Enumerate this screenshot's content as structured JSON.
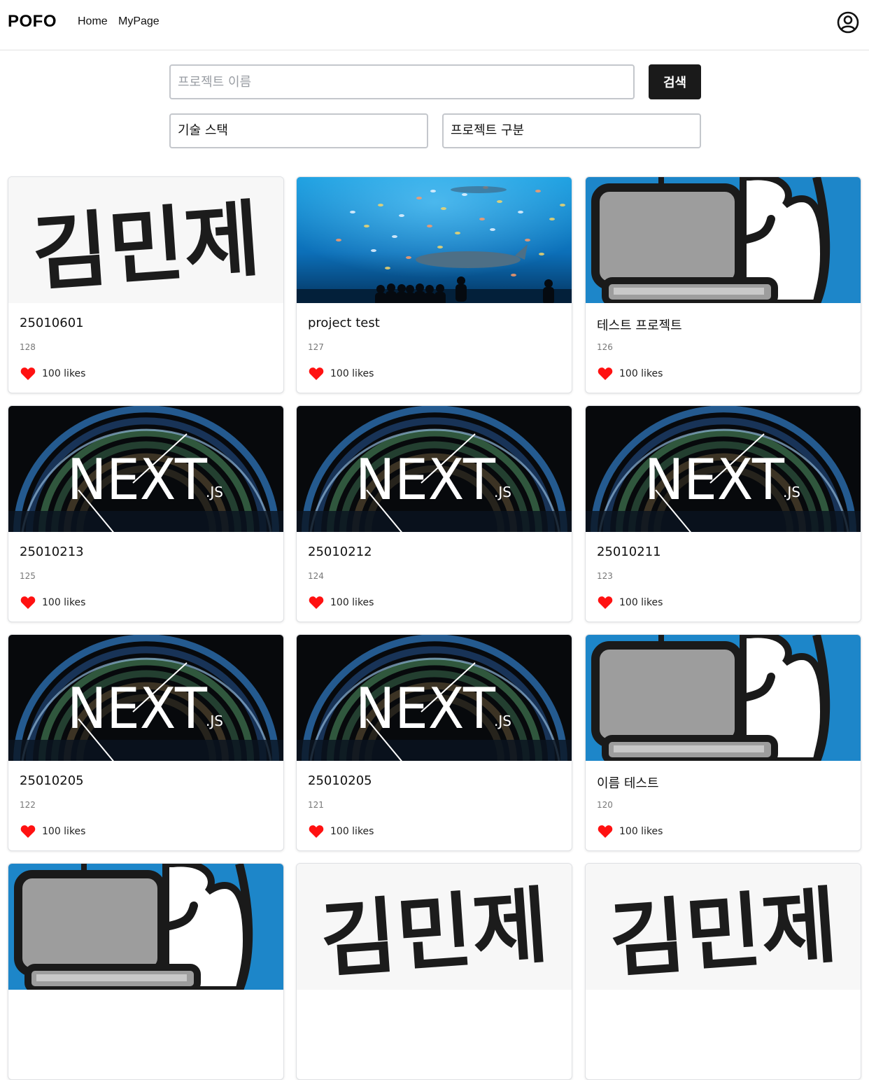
{
  "header": {
    "logo": "POFO",
    "nav": [
      {
        "label": "Home"
      },
      {
        "label": "MyPage"
      }
    ]
  },
  "search": {
    "placeholder": "프로젝트 이름",
    "value": "",
    "button_label": "검색",
    "filters": [
      {
        "label": "기술 스택"
      },
      {
        "label": "프로젝트 구분"
      }
    ]
  },
  "colors": {
    "heart": "#ff1111",
    "button_bg": "#1a1a1a",
    "laptop_bg": "#1d86c9"
  },
  "projects": [
    {
      "title": "25010601",
      "id": "128",
      "likes": "100 likes",
      "thumbnail": "handwriting-image",
      "handwriting": "김민제"
    },
    {
      "title": "project test",
      "id": "127",
      "likes": "100 likes",
      "thumbnail": "aquarium-image"
    },
    {
      "title": "테스트 프로젝트",
      "id": "126",
      "likes": "100 likes",
      "thumbnail": "laptop-cartoon-image"
    },
    {
      "title": "25010213",
      "id": "125",
      "likes": "100 likes",
      "thumbnail": "nextjs-image",
      "logo_text": "NEXT",
      "logo_suffix": ".JS"
    },
    {
      "title": "25010212",
      "id": "124",
      "likes": "100 likes",
      "thumbnail": "nextjs-image",
      "logo_text": "NEXT",
      "logo_suffix": ".JS"
    },
    {
      "title": "25010211",
      "id": "123",
      "likes": "100 likes",
      "thumbnail": "nextjs-image",
      "logo_text": "NEXT",
      "logo_suffix": ".JS"
    },
    {
      "title": "25010205",
      "id": "122",
      "likes": "100 likes",
      "thumbnail": "nextjs-image",
      "logo_text": "NEXT",
      "logo_suffix": ".JS"
    },
    {
      "title": "25010205",
      "id": "121",
      "likes": "100 likes",
      "thumbnail": "nextjs-image",
      "logo_text": "NEXT",
      "logo_suffix": ".JS"
    },
    {
      "title": "이름 테스트",
      "id": "120",
      "likes": "100 likes",
      "thumbnail": "laptop-cartoon-image"
    },
    {
      "title": "",
      "id": "",
      "likes": "",
      "thumbnail": "laptop-cartoon-image"
    },
    {
      "title": "",
      "id": "",
      "likes": "",
      "thumbnail": "handwriting-image",
      "handwriting": "김민제"
    },
    {
      "title": "",
      "id": "",
      "likes": "",
      "thumbnail": "handwriting-image",
      "handwriting": "김민제"
    }
  ]
}
